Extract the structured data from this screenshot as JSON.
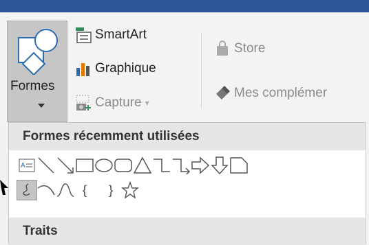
{
  "ribbon": {
    "shapes_button": {
      "label": "Formes"
    },
    "smartart": {
      "label": "SmartArt"
    },
    "graphique": {
      "label": "Graphique"
    },
    "capture": {
      "label": "Capture"
    },
    "store": {
      "label": "Store"
    },
    "mes_complements": {
      "label": "Mes complémer"
    }
  },
  "dropdown": {
    "recent_header": "Formes récemment utilisées",
    "lines_header": "Traits",
    "recent_shapes_row1": [
      "text-box-icon",
      "line-icon",
      "arrow-line-icon",
      "rectangle-icon",
      "oval-icon",
      "rounded-rectangle-icon",
      "triangle-icon",
      "elbow-connector-icon",
      "elbow-arrow-connector-icon",
      "right-arrow-icon",
      "down-arrow-icon",
      "snip-corner-icon"
    ],
    "recent_shapes_row2": [
      "freeform-scribble-icon",
      "arc-icon",
      "curve-icon",
      "left-brace-icon",
      "right-brace-icon",
      "star-icon"
    ],
    "left_brace": "{",
    "right_brace": "}"
  },
  "colors": {
    "title_bar": "#2b579a",
    "selected": "#c6c6c6",
    "accent_orange": "#e07b00",
    "accent_green": "#2e8b57",
    "accent_blue": "#2b6cb0"
  }
}
